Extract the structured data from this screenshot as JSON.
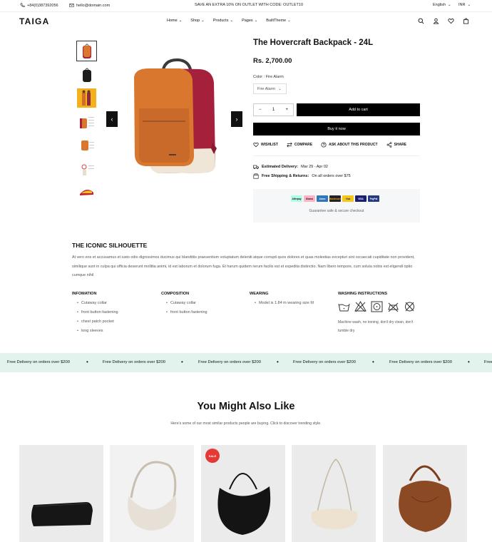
{
  "topbar": {
    "phone": "+84(0)387392056",
    "email": "hello@domain.com",
    "promo": "SAVE AN EXTRA 10% ON OUTLET WITH CODE: OUTLET10",
    "language": "English",
    "currency": "INR"
  },
  "header": {
    "logo": "TAIGA",
    "nav": [
      {
        "label": "Home"
      },
      {
        "label": "Shop"
      },
      {
        "label": "Products"
      },
      {
        "label": "Pages"
      },
      {
        "label": "BuiltTheme"
      }
    ],
    "icons": [
      "search-icon",
      "account-icon",
      "heart-icon",
      "bag-icon"
    ]
  },
  "product": {
    "title": "The Hovercraft Backpack - 24L",
    "price": "Rs. 2,700.00",
    "color_label": "Color : Fire Alarm",
    "color_value": "Fire Alarm",
    "quantity": "1",
    "qty_minus": "−",
    "qty_plus": "+",
    "add_to_cart": "Add to cart",
    "buy_now": "Buy it now",
    "actions": [
      {
        "label": "WISHLIST",
        "icon": "heart-icon"
      },
      {
        "label": "COMPARE",
        "icon": "compare-icon"
      },
      {
        "label": "ASK ABOUT THIS PRODUCT",
        "icon": "question-icon"
      },
      {
        "label": "SHARE",
        "icon": "share-icon"
      }
    ],
    "delivery_label": "Estimated Delivery:",
    "delivery_value": "Mar 29 - Apr 02",
    "shipping_label": "Free Shipping & Returns:",
    "shipping_value": "On all orders over $75",
    "payment_cards": [
      "Afterpay",
      "Klarna",
      "Amex",
      "Mastercard",
      "Visa",
      "VISA",
      "PayPal"
    ],
    "guarantee": "Guarantee safe & secure checkout",
    "colors": {
      "bag_orange": "#d9772f",
      "bag_red": "#a5203a",
      "accent_black": "#000000"
    }
  },
  "description": {
    "title": "THE ICONIC SILHOUETTE",
    "text": "At vero eos et accusamus et iusto odio dignissimos ducimus qui blanditiis praesentium voluptatum deleniti atque corrupti quos dolores et quas molestias excepturi sint occaecati cupiditate non provident, similique sunt in culpa qui officia deserunt mollitia animi, id est laborum et dolorum fuga. Et harum quidem rerum facilis est et expedita distinctio. Nam libero tempore, cum soluta nobis est eligendi optio cumque nihil"
  },
  "details": {
    "information": {
      "title": "INFOMATION",
      "items": [
        "Cutaway collar",
        "front button fastening",
        "chest patch pocket",
        "long sleeves"
      ]
    },
    "composition": {
      "title": "COMPOSITION",
      "items": [
        "Cutaway collar",
        "front button fastening"
      ]
    },
    "wearing": {
      "title": "WEARING",
      "items": [
        "Model is 1.84 m wearing size M"
      ]
    },
    "washing": {
      "title": "WASHING INSTRUCTIONS",
      "note": "Machine wash, no ironing, don't dry clean, don't tumble dry"
    }
  },
  "marquee": {
    "text": "Free Delivery on orders over $200"
  },
  "recommendations": {
    "title": "You Might Also Like",
    "subtitle": "Here's some of our most similar products people are buying. Click to discover trending style.",
    "sale_badge": "SALE"
  }
}
